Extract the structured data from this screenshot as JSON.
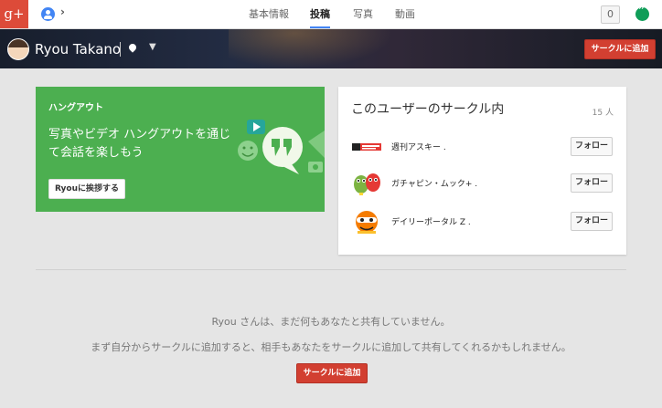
{
  "topbar": {
    "logo_text": "g+",
    "tabs": [
      {
        "label": "基本情報",
        "active": false
      },
      {
        "label": "投稿",
        "active": true
      },
      {
        "label": "写真",
        "active": false
      },
      {
        "label": "動画",
        "active": false
      }
    ],
    "notification_count": "0",
    "accent_color": "#4285f4",
    "brand_color": "#dd4b39"
  },
  "profile": {
    "name": "Ryou Takano",
    "add_to_circle": "サークルに追加"
  },
  "hangout_card": {
    "title": "ハングアウト",
    "description": "写真やビデオ ハングアウトを通じて会話を楽しもう",
    "button": "Ryouに挨拶する",
    "color": "#4caf50"
  },
  "circles_card": {
    "title": "このユーザーのサークル内",
    "count": "15 人",
    "items": [
      {
        "name": "週刊アスキー .",
        "follow": "フォロー",
        "icon": "ascii-logo-icon"
      },
      {
        "name": "ガチャピン・ムック+ .",
        "follow": "フォロー",
        "icon": "gachapin-mukku-icon"
      },
      {
        "name": "デイリーポータル Z .",
        "follow": "フォロー",
        "icon": "daily-portal-z-icon"
      }
    ]
  },
  "empty_state": {
    "line1": "Ryou さんは、まだ何もあなたと共有していません。",
    "line2": "まず自分からサークルに追加すると、相手もあなたをサークルに追加して共有してくれるかもしれません。",
    "button": "サークルに追加",
    "button_color": "#d23f31"
  }
}
